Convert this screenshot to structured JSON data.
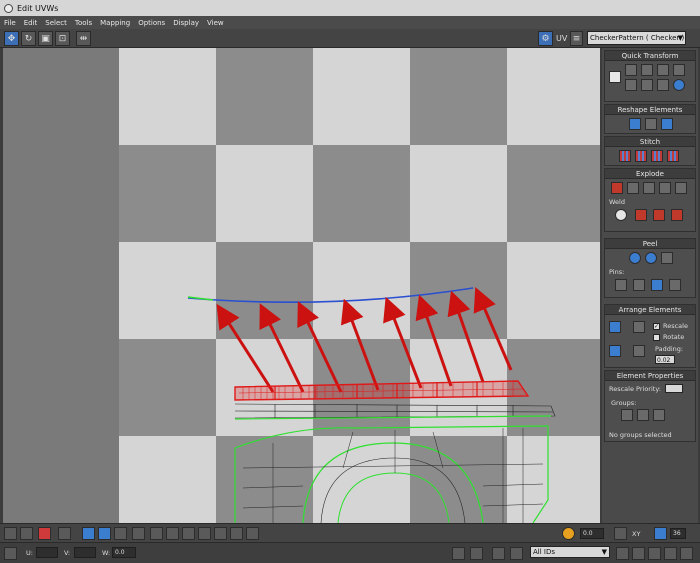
{
  "window": {
    "title": "Edit UVWs"
  },
  "menu": [
    "File",
    "Edit",
    "Select",
    "Tools",
    "Mapping",
    "Options",
    "Display",
    "View"
  ],
  "toolbar": {
    "tools": [
      "move-tool",
      "rotate-tool",
      "scale-tool",
      "freeform-tool",
      "mirror-tool"
    ],
    "uv_label": "UV",
    "map_select": "CheckerPattern  ( Checker )"
  },
  "panel": {
    "quick_transform": {
      "title": "Quick Transform"
    },
    "reshape": {
      "title": "Reshape Elements"
    },
    "stitch": {
      "title": "Stitch"
    },
    "explode": {
      "title": "Explode",
      "weld_label": "Weld"
    },
    "peel": {
      "title": "Peel",
      "pins_label": "Pins:"
    },
    "arrange": {
      "title": "Arrange Elements",
      "rescale": "Rescale",
      "rotate": "Rotate",
      "padding_label": "Padding:",
      "padding_value": "0.02"
    },
    "element_props": {
      "title": "Element Properties",
      "rescale_priority": "Rescale Priority:",
      "groups_label": "Groups:",
      "no_groups": "No groups selected"
    }
  },
  "bottom": {
    "value_field": "0.0",
    "xy_label": "XY",
    "zoom_value": "36",
    "u_label": "U:",
    "v_label": "V:",
    "w_label": "W:",
    "w_value": "0.0",
    "ids_select": "All IDs"
  },
  "colors": {
    "checker_light": "#d5d5d5",
    "checker_dark": "#8c8c8c",
    "arrow_red": "#cc1111",
    "selection_red": "#e01818",
    "uv_green": "#2fe02f",
    "edge_blue": "#2a4fd0"
  }
}
